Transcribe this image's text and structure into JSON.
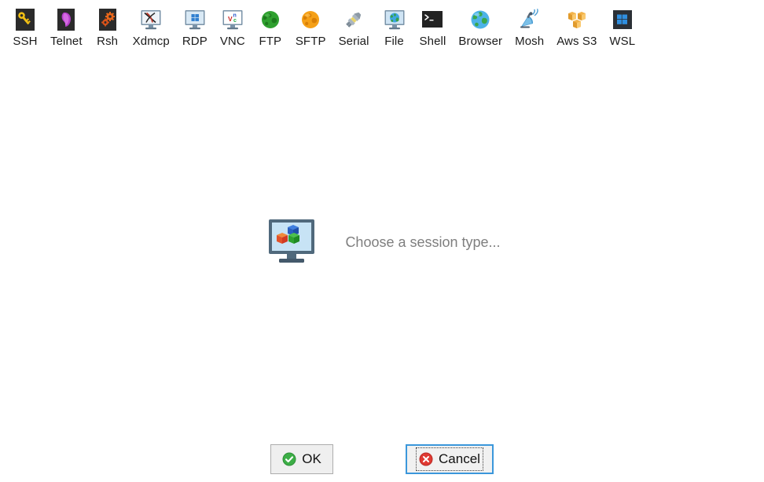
{
  "window": {
    "background": "#ffffff"
  },
  "toolbar": {
    "items": [
      {
        "label": "SSH",
        "icon": "ssh-key-icon"
      },
      {
        "label": "Telnet",
        "icon": "telnet-icon"
      },
      {
        "label": "Rsh",
        "icon": "rsh-gears-icon"
      },
      {
        "label": "Xdmcp",
        "icon": "xdmcp-monitor-icon"
      },
      {
        "label": "RDP",
        "icon": "rdp-windows-monitor-icon"
      },
      {
        "label": "VNC",
        "icon": "vnc-monitor-icon"
      },
      {
        "label": "FTP",
        "icon": "ftp-green-globe-icon"
      },
      {
        "label": "SFTP",
        "icon": "sftp-orange-globe-icon"
      },
      {
        "label": "Serial",
        "icon": "serial-plug-icon"
      },
      {
        "label": "File",
        "icon": "file-monitor-globe-icon"
      },
      {
        "label": "Shell",
        "icon": "shell-terminal-icon"
      },
      {
        "label": "Browser",
        "icon": "browser-globe-icon"
      },
      {
        "label": "Mosh",
        "icon": "mosh-satellite-icon"
      },
      {
        "label": "Aws S3",
        "icon": "aws-s3-buckets-icon"
      },
      {
        "label": "WSL",
        "icon": "wsl-windows-icon"
      }
    ]
  },
  "main": {
    "placeholder_icon": "session-type-monitor-icon",
    "placeholder_text": "Choose a session type...",
    "placeholder_text_color": "#7f7f7f"
  },
  "footer": {
    "ok_label": "OK",
    "ok_icon": "green-check-circle-icon",
    "cancel_label": "Cancel",
    "cancel_icon": "red-x-circle-icon",
    "focused_button": "Cancel",
    "focus_color": "#3b97db"
  }
}
